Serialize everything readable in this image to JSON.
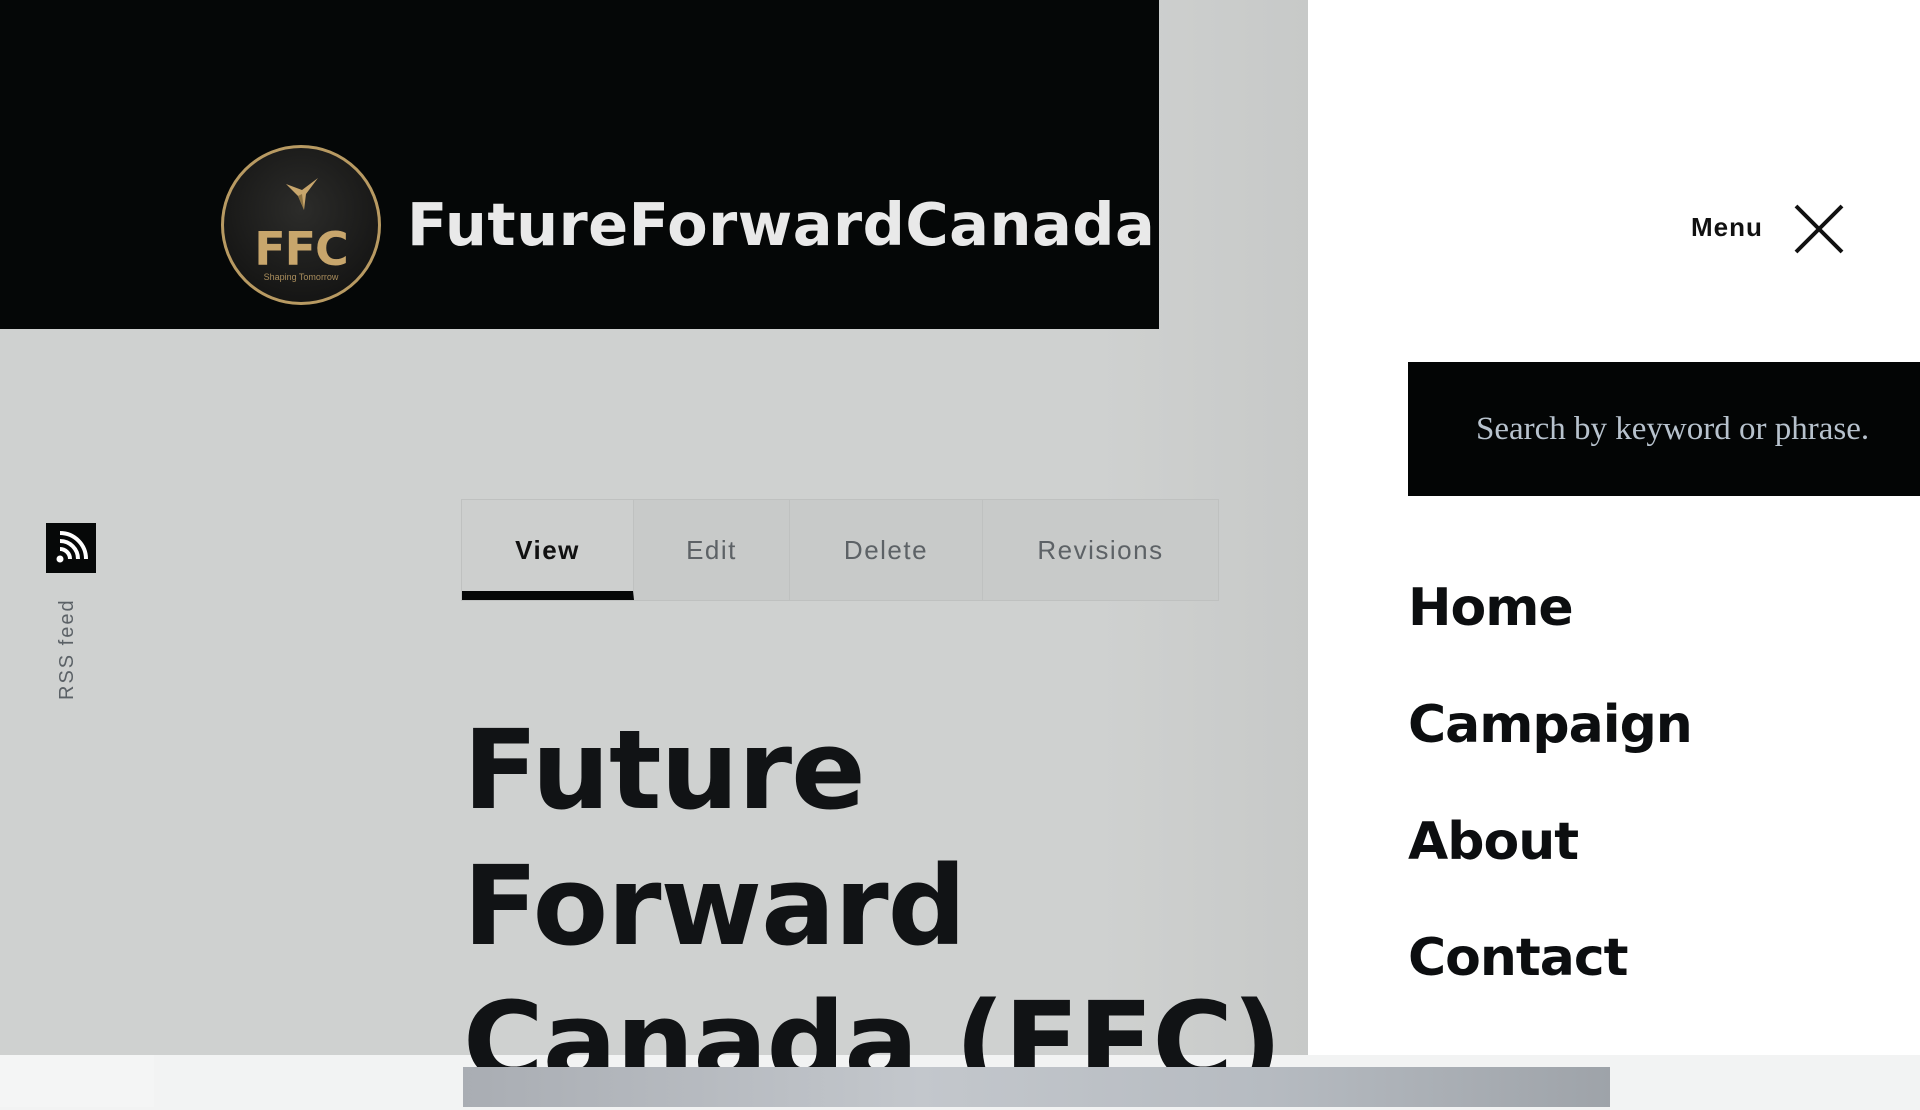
{
  "header": {
    "site_name": "FutureForwardCanada",
    "logo": {
      "initials": "FFC",
      "tagline": "Shaping Tomorrow",
      "accent": "#c8a66c"
    }
  },
  "rss": {
    "label": "RSS feed",
    "icon": "rss-icon"
  },
  "tabs": [
    {
      "label": "View",
      "active": true
    },
    {
      "label": "Edit",
      "active": false
    },
    {
      "label": "Delete",
      "active": false
    },
    {
      "label": "Revisions",
      "active": false
    }
  ],
  "page": {
    "title": "Future Forward Canada (FFC)"
  },
  "menu": {
    "label": "Menu",
    "close_icon": "close-icon",
    "search_placeholder": "Search by keyword or phrase.",
    "items": [
      {
        "label": "Home"
      },
      {
        "label": "Campaign"
      },
      {
        "label": "About"
      },
      {
        "label": "Contact"
      }
    ]
  },
  "colors": {
    "header_bg": "#050707",
    "panel_bg": "#cfd1d0",
    "menu_bg": "#ffffff",
    "search_bg": "#030505"
  }
}
